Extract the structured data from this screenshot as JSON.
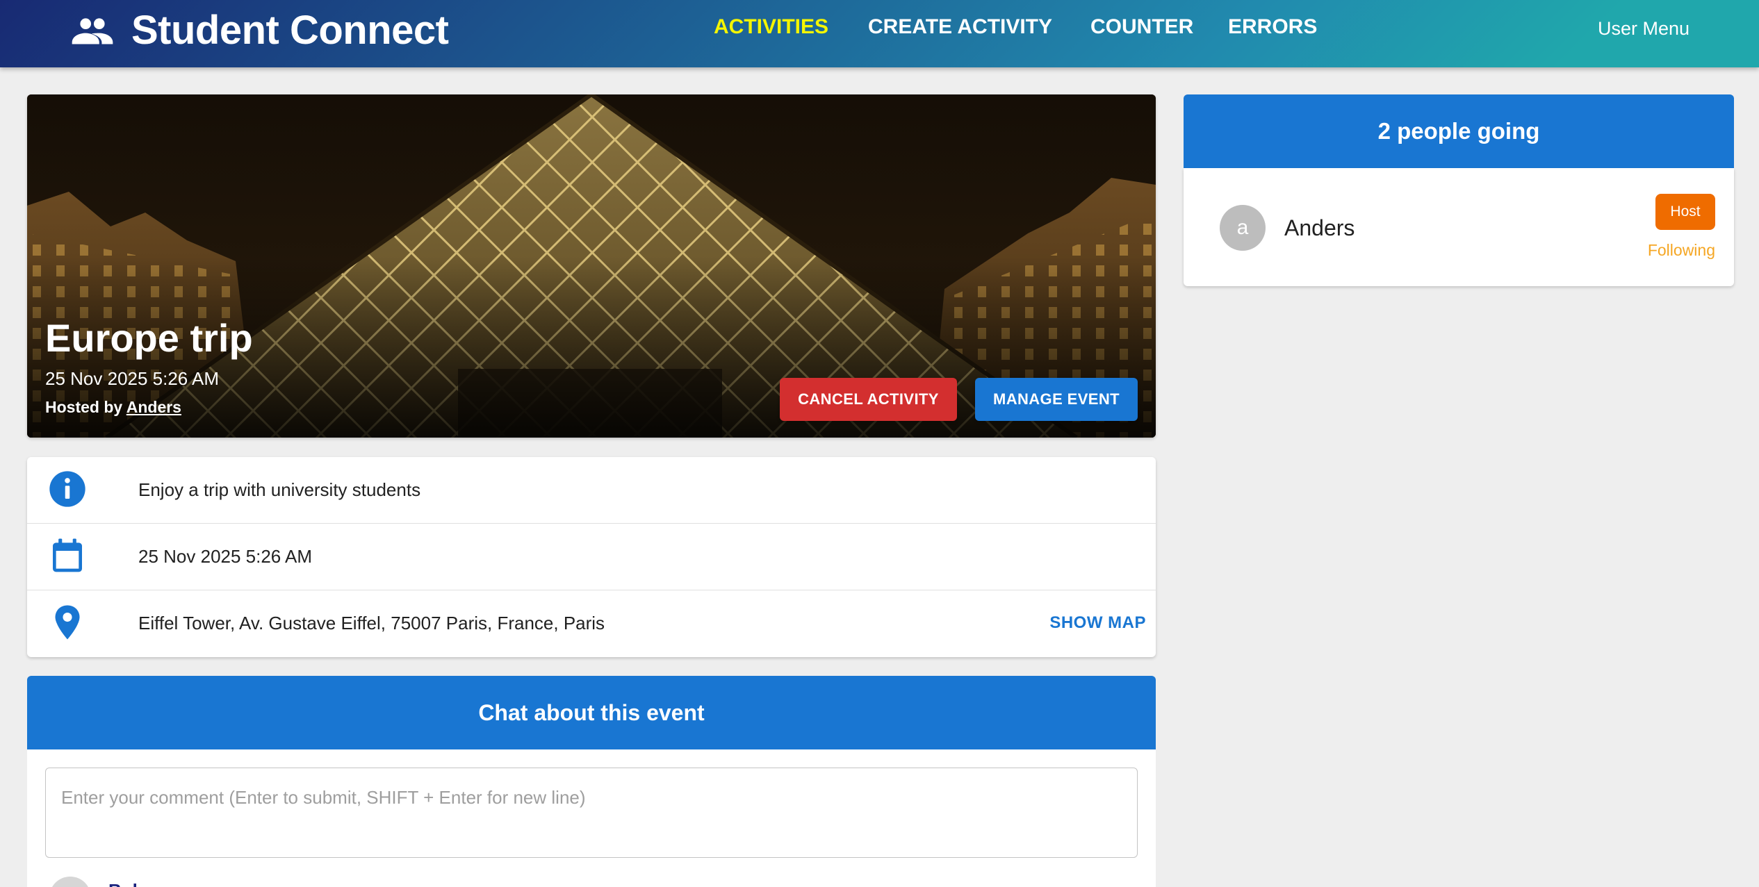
{
  "appbar": {
    "title": "Student Connect",
    "icon": "people-icon",
    "nav": [
      {
        "label": "ACTIVITIES",
        "active": true
      },
      {
        "label": "CREATE ACTIVITY",
        "active": false
      },
      {
        "label": "COUNTER",
        "active": false
      },
      {
        "label": "ERRORS",
        "active": false
      }
    ],
    "user_menu": "User Menu"
  },
  "activity": {
    "title": "Europe trip",
    "date": "25 Nov 2025 5:26 AM",
    "hosted_by_prefix": "Hosted by",
    "host_name": "Anders",
    "cancel_label": "CANCEL ACTIVITY",
    "manage_label": "MANAGE EVENT",
    "image": "louvre-pyramid-night-photo"
  },
  "details": {
    "description": "Enjoy a trip with university students",
    "date": "25 Nov 2025 5:26 AM",
    "venue": "Eiffel Tower, Av. Gustave Eiffel, 75007 Paris, France, Paris",
    "show_map_label": "SHOW MAP",
    "icons": [
      "info-icon",
      "calendar-icon",
      "location-pin-icon"
    ]
  },
  "chat": {
    "header": "Chat about this event",
    "placeholder": "Enter your comment (Enter to submit, SHIFT + Enter for new line)",
    "first_comment_author": "Bob"
  },
  "attendees": {
    "header": "2 people going",
    "list": [
      {
        "initial": "a",
        "name": "Anders",
        "badge": "Host",
        "status": "Following"
      }
    ]
  },
  "colors": {
    "primary": "#1976d2",
    "danger": "#d32f2f",
    "host_badge": "#ef6c00",
    "following": "#f5a623",
    "nav_active": "#f5f500"
  }
}
